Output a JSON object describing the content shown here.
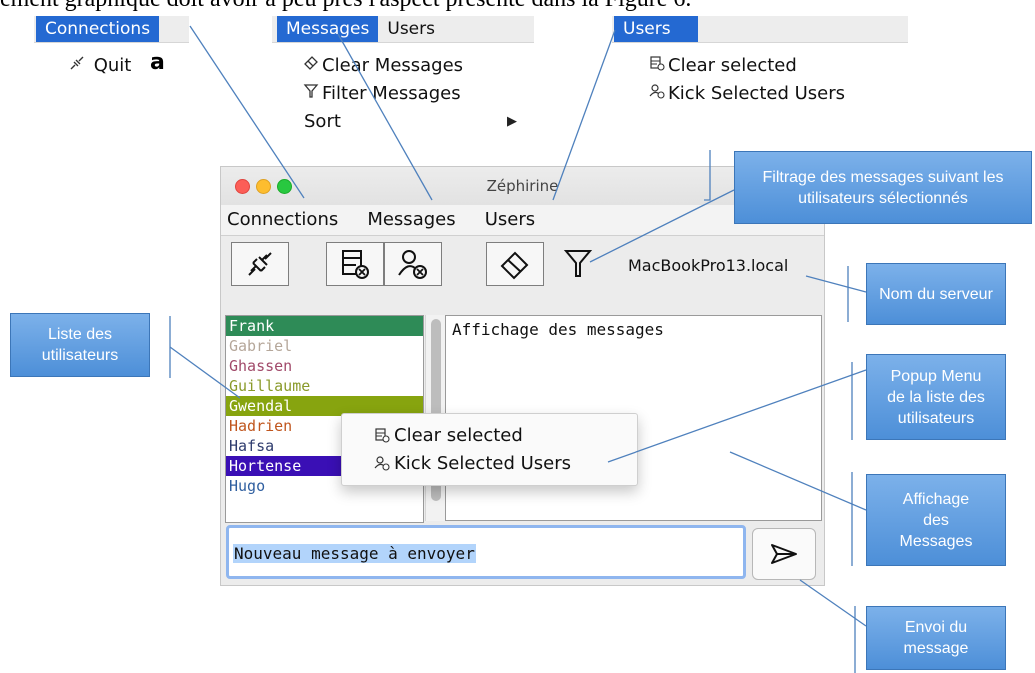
{
  "heading_text": "ement graphique doit avoir à peu près l'aspect présenté dans la Figure 6.",
  "menu_connections": {
    "title": "Connections",
    "quit_label": "Quit",
    "fragment": "a"
  },
  "menu_messages": {
    "titles": [
      "Messages",
      "Users"
    ],
    "items": [
      "Clear Messages",
      "Filter Messages",
      "Sort"
    ],
    "submenu_arrow": "▶"
  },
  "menu_users": {
    "title": "Users",
    "items": [
      "Clear selected",
      "Kick Selected Users"
    ]
  },
  "window": {
    "title": "Zéphirine",
    "menubar": [
      "Connections",
      "Messages",
      "Users"
    ],
    "server_name": "MacBookPro13.local",
    "users": [
      {
        "name": "Frank",
        "color": "#ffffff",
        "bg": "#2e8b57"
      },
      {
        "name": "Gabriel",
        "color": "#b5a79a",
        "bg": ""
      },
      {
        "name": "Ghassen",
        "color": "#a14a6a",
        "bg": ""
      },
      {
        "name": "Guillaume",
        "color": "#8a9a2a",
        "bg": ""
      },
      {
        "name": "Gwendal",
        "color": "#ffffff",
        "bg": "#87a40f"
      },
      {
        "name": "Hadrien",
        "color": "#c0561e",
        "bg": ""
      },
      {
        "name": "Hafsa",
        "color": "#2f3c6e",
        "bg": ""
      },
      {
        "name": "Hortense",
        "color": "#ffffff",
        "bg": "#3a0fb5"
      },
      {
        "name": "Hugo",
        "color": "#2f5fa0",
        "bg": ""
      }
    ],
    "messages_placeholder": "Affichage des messages",
    "input_value": "Nouveau message à envoyer"
  },
  "popup_menu": {
    "items": [
      "Clear selected",
      "Kick Selected Users"
    ]
  },
  "callouts": {
    "filter": "Filtrage des messages suivant les utilisateurs sélectionnés",
    "server": "Nom du serveur",
    "users_list": "Liste des utilisateurs",
    "popup": "Popup Menu de la liste des utilisateurs",
    "messages": "Affichage des Messages",
    "send": "Envoi du message"
  },
  "colors": {
    "selection_blue": "#2469d2",
    "callout_blue": "#5b9be0"
  }
}
